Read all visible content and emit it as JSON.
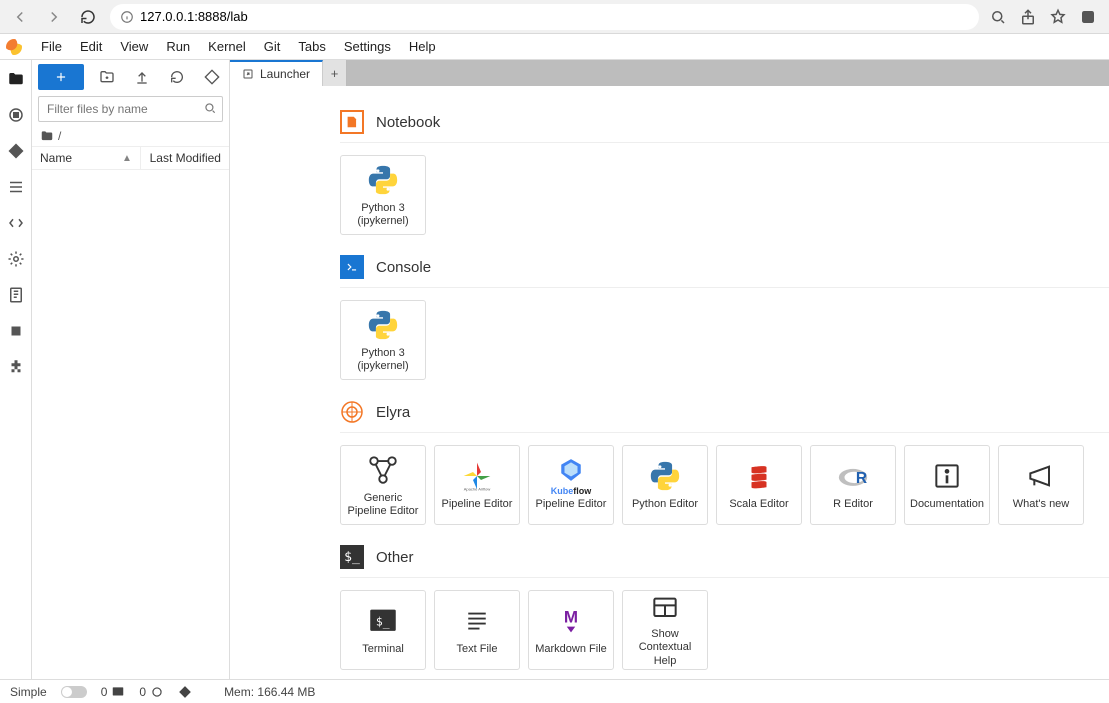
{
  "browser": {
    "url": "127.0.0.1:8888/lab"
  },
  "menu": [
    "File",
    "Edit",
    "View",
    "Run",
    "Kernel",
    "Git",
    "Tabs",
    "Settings",
    "Help"
  ],
  "filebrowser": {
    "filter_placeholder": "Filter files by name",
    "breadcrumb": "/",
    "col_name": "Name",
    "col_modified": "Last Modified"
  },
  "tab": {
    "title": "Launcher"
  },
  "launcher": {
    "sections": [
      {
        "title": "Notebook",
        "icon": "notebook",
        "cards": [
          {
            "label": "Python 3\n(ipykernel)",
            "icon": "python"
          }
        ]
      },
      {
        "title": "Console",
        "icon": "console",
        "cards": [
          {
            "label": "Python 3\n(ipykernel)",
            "icon": "python"
          }
        ]
      },
      {
        "title": "Elyra",
        "icon": "elyra",
        "cards": [
          {
            "label": "Generic Pipeline Editor",
            "icon": "pipeline"
          },
          {
            "label": "Pipeline Editor",
            "icon": "airflow"
          },
          {
            "label": "Pipeline Editor",
            "icon": "kubeflow"
          },
          {
            "label": "Python Editor",
            "icon": "python"
          },
          {
            "label": "Scala Editor",
            "icon": "scala"
          },
          {
            "label": "R Editor",
            "icon": "r"
          },
          {
            "label": "Documentation",
            "icon": "info"
          },
          {
            "label": "What's new",
            "icon": "megaphone"
          }
        ]
      },
      {
        "title": "Other",
        "icon": "other",
        "cards": [
          {
            "label": "Terminal",
            "icon": "terminal"
          },
          {
            "label": "Text File",
            "icon": "text"
          },
          {
            "label": "Markdown File",
            "icon": "markdown"
          },
          {
            "label": "Show Contextual Help",
            "icon": "help-panel"
          }
        ]
      }
    ]
  },
  "status": {
    "simple": "Simple",
    "terminals": "0",
    "kernels": "0",
    "mem": "Mem: 166.44 MB"
  }
}
